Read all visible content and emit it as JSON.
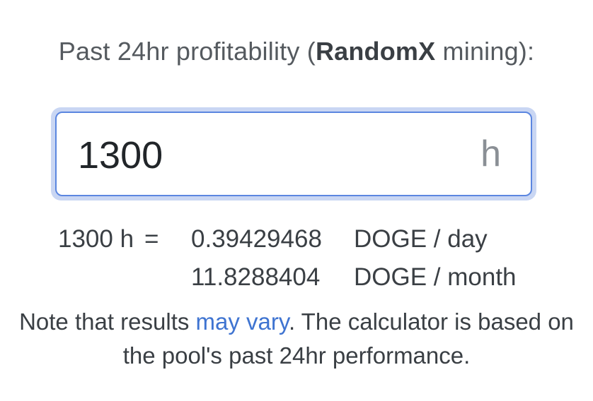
{
  "heading": {
    "prefix": "Past 24hr profitability (",
    "algorithm": "RandomX",
    "suffix": " mining):"
  },
  "hashrate_input": {
    "value": "1300",
    "unit": "h"
  },
  "results": {
    "rate_label": "1300 h",
    "equals": "=",
    "rows": [
      {
        "value": "0.39429468",
        "unit": "DOGE / day"
      },
      {
        "value": "11.8288404",
        "unit": "DOGE / month"
      }
    ]
  },
  "note": {
    "before": "Note that results ",
    "link": "may vary",
    "after": ". The calculator is based on the pool's past 24hr performance."
  }
}
